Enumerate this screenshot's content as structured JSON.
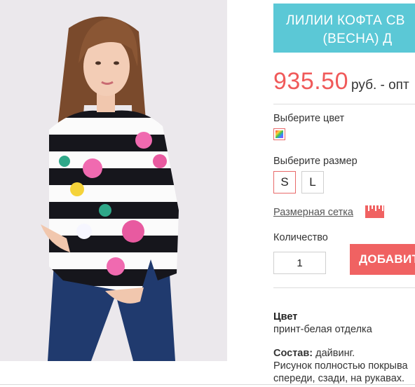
{
  "product": {
    "title_line1": "ЛИЛИИ КОФТА СВ",
    "title_line2": "(ВЕСНА) Д",
    "price": "935.50",
    "price_unit": "руб. - опт"
  },
  "options": {
    "color_label": "Выберите цвет",
    "size_label": "Выберите размер",
    "sizes": [
      "S",
      "L"
    ],
    "selected_size": "S",
    "size_chart_link": "Размерная сетка",
    "quantity_label": "Количество",
    "quantity_value": "1",
    "add_button": "ДОБАВИТ"
  },
  "specs": {
    "color_title": "Цвет",
    "color_value": "принт-белая отделка",
    "composition_title": "Состав:",
    "composition_value": "дайвинг.",
    "print_line1": "Рисунок полностью покрыва",
    "print_line2": "спереди, сзади, на рукавах."
  },
  "colors": {
    "banner": "#5bc8d6",
    "price": "#f05a5a",
    "button": "#f06262",
    "selected_border": "#e86a6a"
  }
}
